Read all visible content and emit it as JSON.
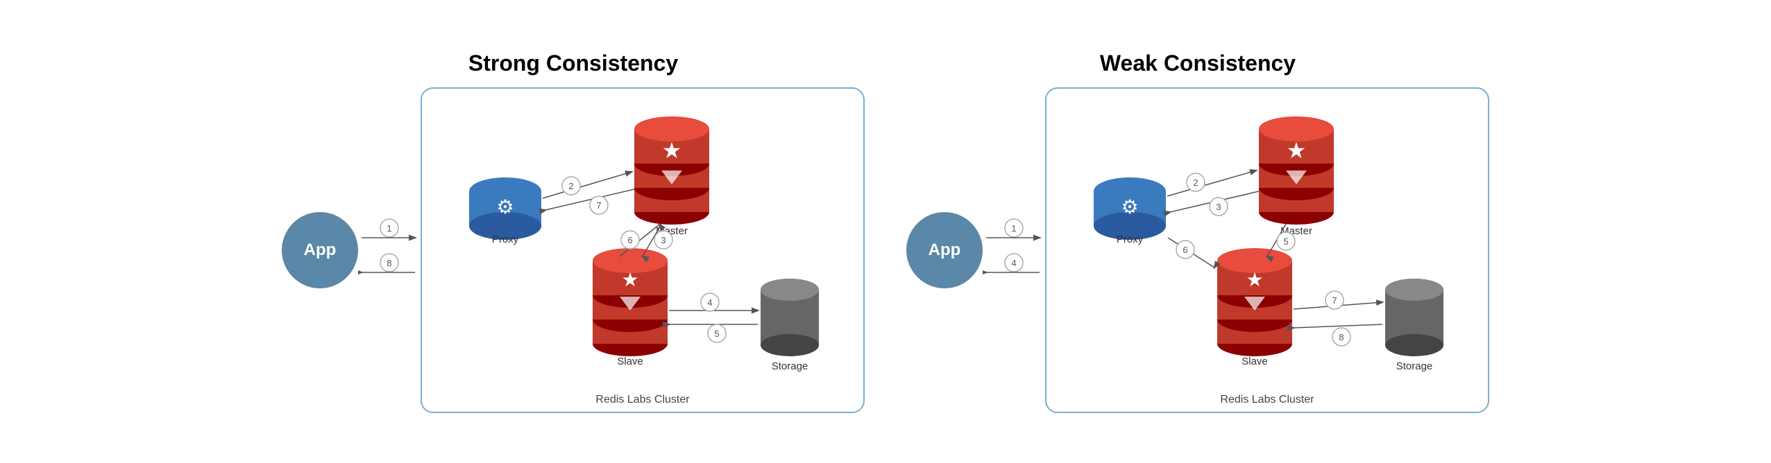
{
  "strong": {
    "title": "Strong Consistency",
    "cluster_label": "Redis Labs Cluster",
    "app_label": "App",
    "proxy_label": "Proxy",
    "master_label": "Master",
    "slave_label": "Slave",
    "storage_label": "Storage",
    "steps": [
      "1",
      "2",
      "3",
      "4",
      "5",
      "6",
      "7",
      "8"
    ]
  },
  "weak": {
    "title": "Weak Consistency",
    "cluster_label": "Redis Labs Cluster",
    "app_label": "App",
    "proxy_label": "Proxy",
    "master_label": "Master",
    "slave_label": "Slave",
    "storage_label": "Storage",
    "steps": [
      "1",
      "2",
      "3",
      "4",
      "5",
      "6",
      "7",
      "8"
    ]
  }
}
